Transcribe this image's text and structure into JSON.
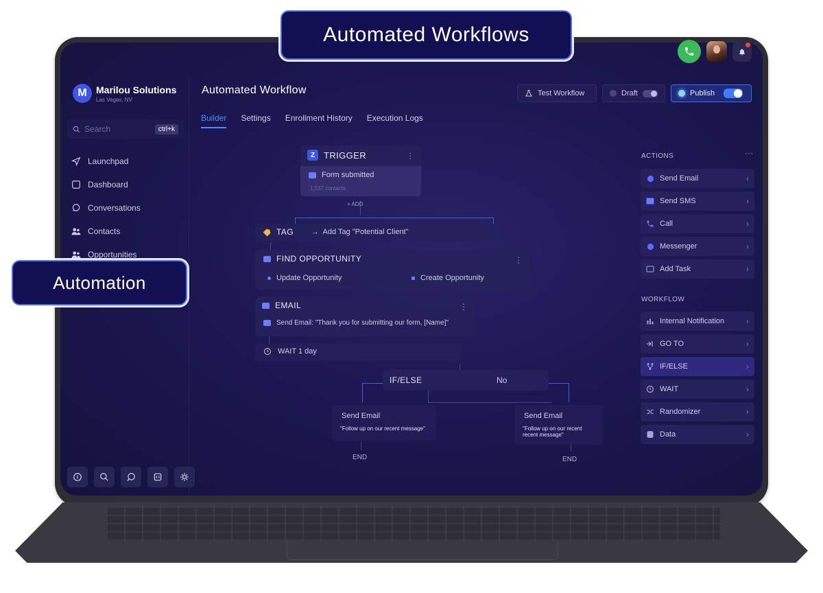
{
  "callouts": {
    "top": "Automated Workflows",
    "left": "Automation"
  },
  "brand": {
    "logo_letter": "M",
    "name": "Marilou Solutions",
    "location": "Las Vegas, NV"
  },
  "search": {
    "placeholder": "Search",
    "shortcut": "ctrl+k"
  },
  "nav": [
    {
      "label": "Launchpad",
      "icon": "send-icon"
    },
    {
      "label": "Dashboard",
      "icon": "square-icon"
    },
    {
      "label": "Conversations",
      "icon": "chat-icon"
    },
    {
      "label": "Contacts",
      "icon": "people-icon"
    },
    {
      "label": "Opportunities",
      "icon": "people-icon"
    }
  ],
  "bottom_icons": [
    "info-icon",
    "search-icon",
    "chat-icon",
    "id-icon",
    "gear-icon"
  ],
  "header": {
    "title": "Automated Workflow",
    "tabs": [
      "Builder",
      "Settings",
      "Enrollment History",
      "Execution Logs"
    ],
    "active_tab": "Builder",
    "test_label": "Test Workflow",
    "draft_label": "Draft",
    "publish_label": "Publish"
  },
  "workflow": {
    "trigger": {
      "badge": "Z",
      "title": "TRIGGER",
      "item": "Form submitted",
      "contacts": "1,537 contacts",
      "add": "ADD"
    },
    "tag": {
      "title": "TAG",
      "action": "Add Tag \"Potential Client\""
    },
    "find": {
      "title": "FIND OPPORTUNITY",
      "update": "Update Opportunity",
      "create": "Create Opportunity"
    },
    "email": {
      "title": "EMAIL",
      "text": "Send Email: \"Thank you for submitting our form, [Name]\""
    },
    "wait": {
      "text": "WAIT 1 day"
    },
    "ifelse": {
      "title": "IF/ELSE",
      "no": "No"
    },
    "left_branch": {
      "title": "Send Email",
      "text": "\"Follow up on our recent message\"",
      "end": "END"
    },
    "right_branch": {
      "title": "Send Email",
      "text": "\"Follow up on our recent recent message\"",
      "end": "END"
    }
  },
  "panel": {
    "actions_label": "ACTIONS",
    "actions": [
      {
        "label": "Send Email",
        "icon": "email-icon"
      },
      {
        "label": "Send SMS",
        "icon": "sms-icon"
      },
      {
        "label": "Call",
        "icon": "phone-icon"
      },
      {
        "label": "Messenger",
        "icon": "messenger-icon"
      },
      {
        "label": "Add Task",
        "icon": "task-icon"
      }
    ],
    "workflow_label": "WORKFLOW",
    "workflow": [
      {
        "label": "Internal Notification",
        "icon": "notification-icon"
      },
      {
        "label": "GO TO",
        "icon": "goto-icon"
      },
      {
        "label": "IF/ELSE",
        "icon": "branch-icon",
        "selected": true
      },
      {
        "label": "WAIT",
        "icon": "clock-icon"
      },
      {
        "label": "Randomizer",
        "icon": "shuffle-icon"
      },
      {
        "label": "Data",
        "icon": "database-icon"
      }
    ]
  },
  "colors": {
    "accent": "#4d8dff",
    "callout_border": "#4a6ef5",
    "screen_bg": "#1c1752",
    "call_green": "#3cb95a"
  }
}
